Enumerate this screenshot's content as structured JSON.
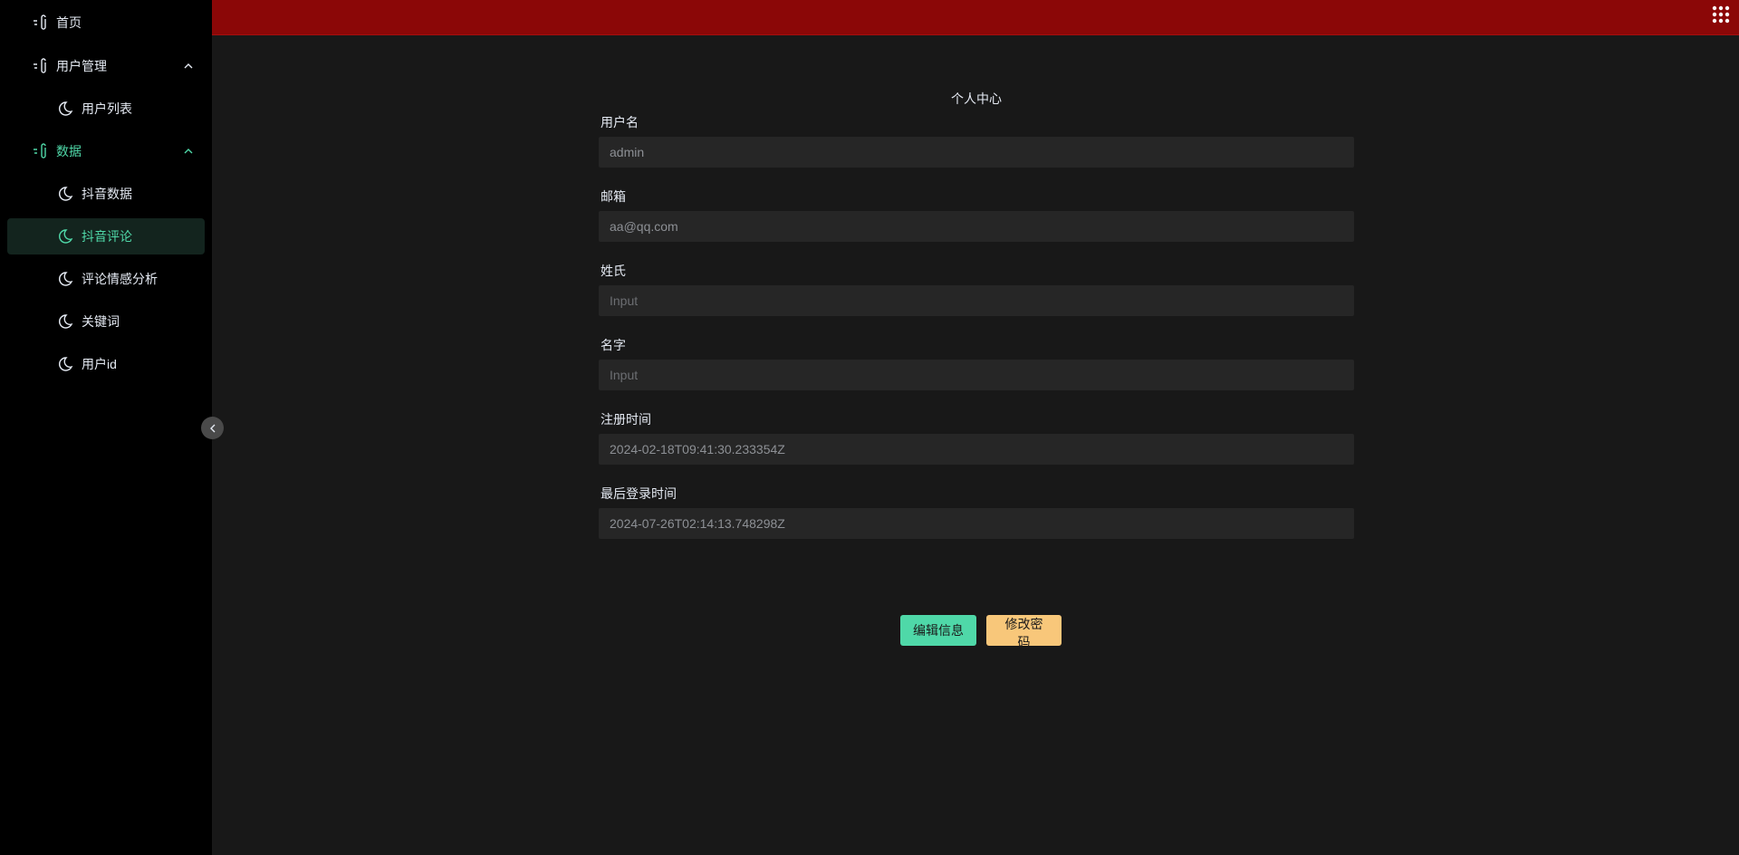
{
  "sidebar": {
    "items": [
      {
        "label": "首页"
      },
      {
        "label": "用户管理"
      },
      {
        "label": "用户列表"
      },
      {
        "label": "数据"
      },
      {
        "label": "抖音数据"
      },
      {
        "label": "抖音评论"
      },
      {
        "label": "评论情感分析"
      },
      {
        "label": "关键词"
      },
      {
        "label": "用户id"
      }
    ],
    "accent_color": "#4fd8a8"
  },
  "topbar": {
    "color": "#8b0707"
  },
  "form": {
    "title": "个人中心",
    "fields": [
      {
        "label": "用户名",
        "value": "admin",
        "placeholder": ""
      },
      {
        "label": "邮箱",
        "value": "aa@qq.com",
        "placeholder": ""
      },
      {
        "label": "姓氏",
        "value": "",
        "placeholder": "Input"
      },
      {
        "label": "名字",
        "value": "",
        "placeholder": "Input"
      },
      {
        "label": "注册时间",
        "value": "2024-02-18T09:41:30.233354Z",
        "placeholder": ""
      },
      {
        "label": "最后登录时间",
        "value": "2024-07-26T02:14:13.748298Z",
        "placeholder": ""
      }
    ],
    "edit_button": "编辑信息",
    "password_button": "修改密码"
  }
}
